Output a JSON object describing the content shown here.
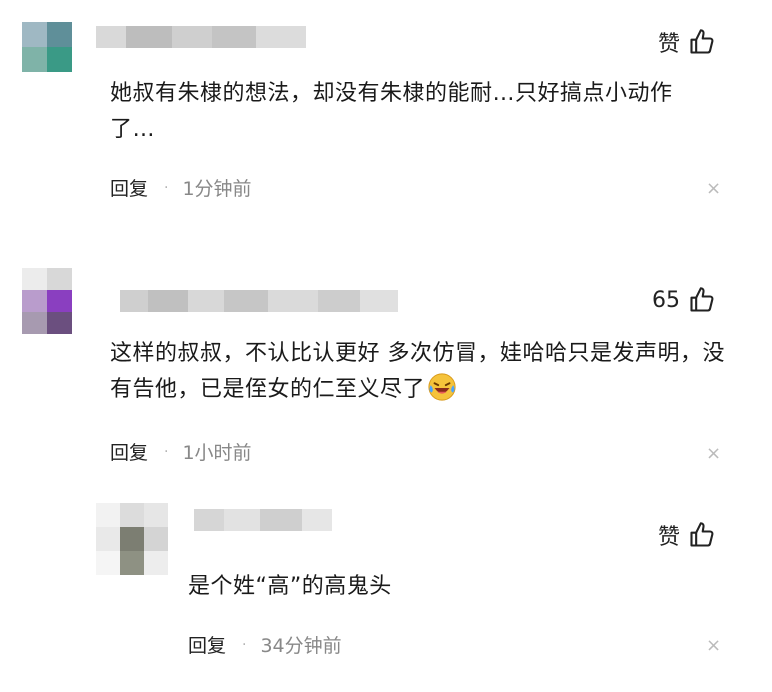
{
  "comments": [
    {
      "like_label": "赞",
      "text": "她叔有朱棣的想法，却没有朱棣的能耐…只好搞点小动作了…",
      "reply_label": "回复",
      "time": "1分钟前",
      "close_glyph": "×"
    },
    {
      "like_label": "65",
      "text": "这样的叔叔，不认比认更好 多次仿冒，娃哈哈只是发声明，没有告他，已是侄女的仁至义尽了",
      "reply_label": "回复",
      "time": "1小时前",
      "close_glyph": "×",
      "emoji": "laughing-crying-emoji"
    },
    {
      "like_label": "赞",
      "text": "是个姓“高”的高鬼头",
      "reply_label": "回复",
      "time": "34分钟前",
      "close_glyph": "×"
    }
  ],
  "separator_glyph": "·",
  "colors": {
    "text": "#1a1a1a",
    "meta": "#888888",
    "close": "#bbbbbb"
  }
}
